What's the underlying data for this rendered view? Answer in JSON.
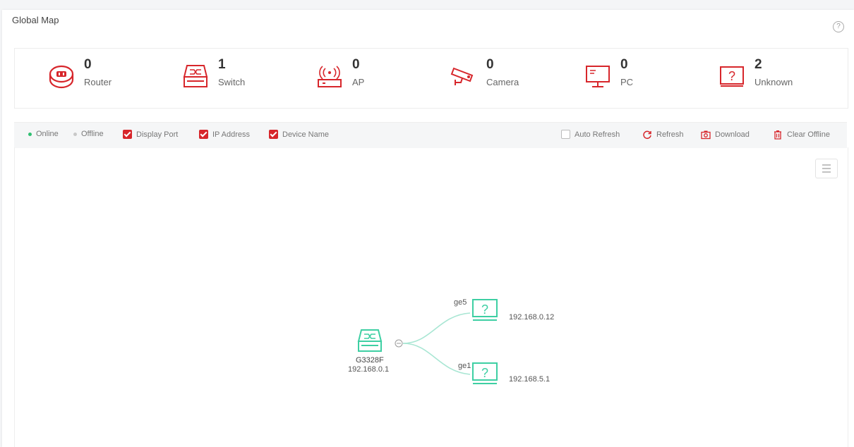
{
  "header": {
    "title": "Global Map",
    "help_glyph": "?"
  },
  "summary": [
    {
      "key": "router",
      "count": "0",
      "label": "Router",
      "icon": "router-icon"
    },
    {
      "key": "switch",
      "count": "1",
      "label": "Switch",
      "icon": "switch-icon"
    },
    {
      "key": "ap",
      "count": "0",
      "label": "AP",
      "icon": "ap-icon"
    },
    {
      "key": "camera",
      "count": "0",
      "label": "Camera",
      "icon": "camera-icon"
    },
    {
      "key": "pc",
      "count": "0",
      "label": "PC",
      "icon": "pc-icon"
    },
    {
      "key": "unknown",
      "count": "2",
      "label": "Unknown",
      "icon": "unknown-device-icon"
    }
  ],
  "toolbar": {
    "legend": [
      {
        "label": "Online",
        "color": "#2fbf71"
      },
      {
        "label": "Offline",
        "color": "#c8c8c8"
      }
    ],
    "filters": [
      {
        "label": "Display Port",
        "checked": true
      },
      {
        "label": "IP Address",
        "checked": true
      },
      {
        "label": "Device Name",
        "checked": true
      }
    ],
    "auto_refresh": {
      "label": "Auto Refresh",
      "checked": false
    },
    "refresh_label": "Refresh",
    "download_label": "Download",
    "clear_offline_label": "Clear Offline"
  },
  "topology": {
    "root": {
      "name": "G3328F",
      "ip": "192.168.0.1",
      "type": "switch"
    },
    "children": [
      {
        "port": "ge5",
        "ip": "192.168.0.12",
        "type": "unknown",
        "glyph": "?"
      },
      {
        "port": "ge1",
        "ip": "192.168.5.1",
        "type": "unknown",
        "glyph": "?"
      }
    ]
  },
  "colors": {
    "accent": "#d7262b",
    "online": "#3ecfa3",
    "link": "#a8e6d3"
  }
}
